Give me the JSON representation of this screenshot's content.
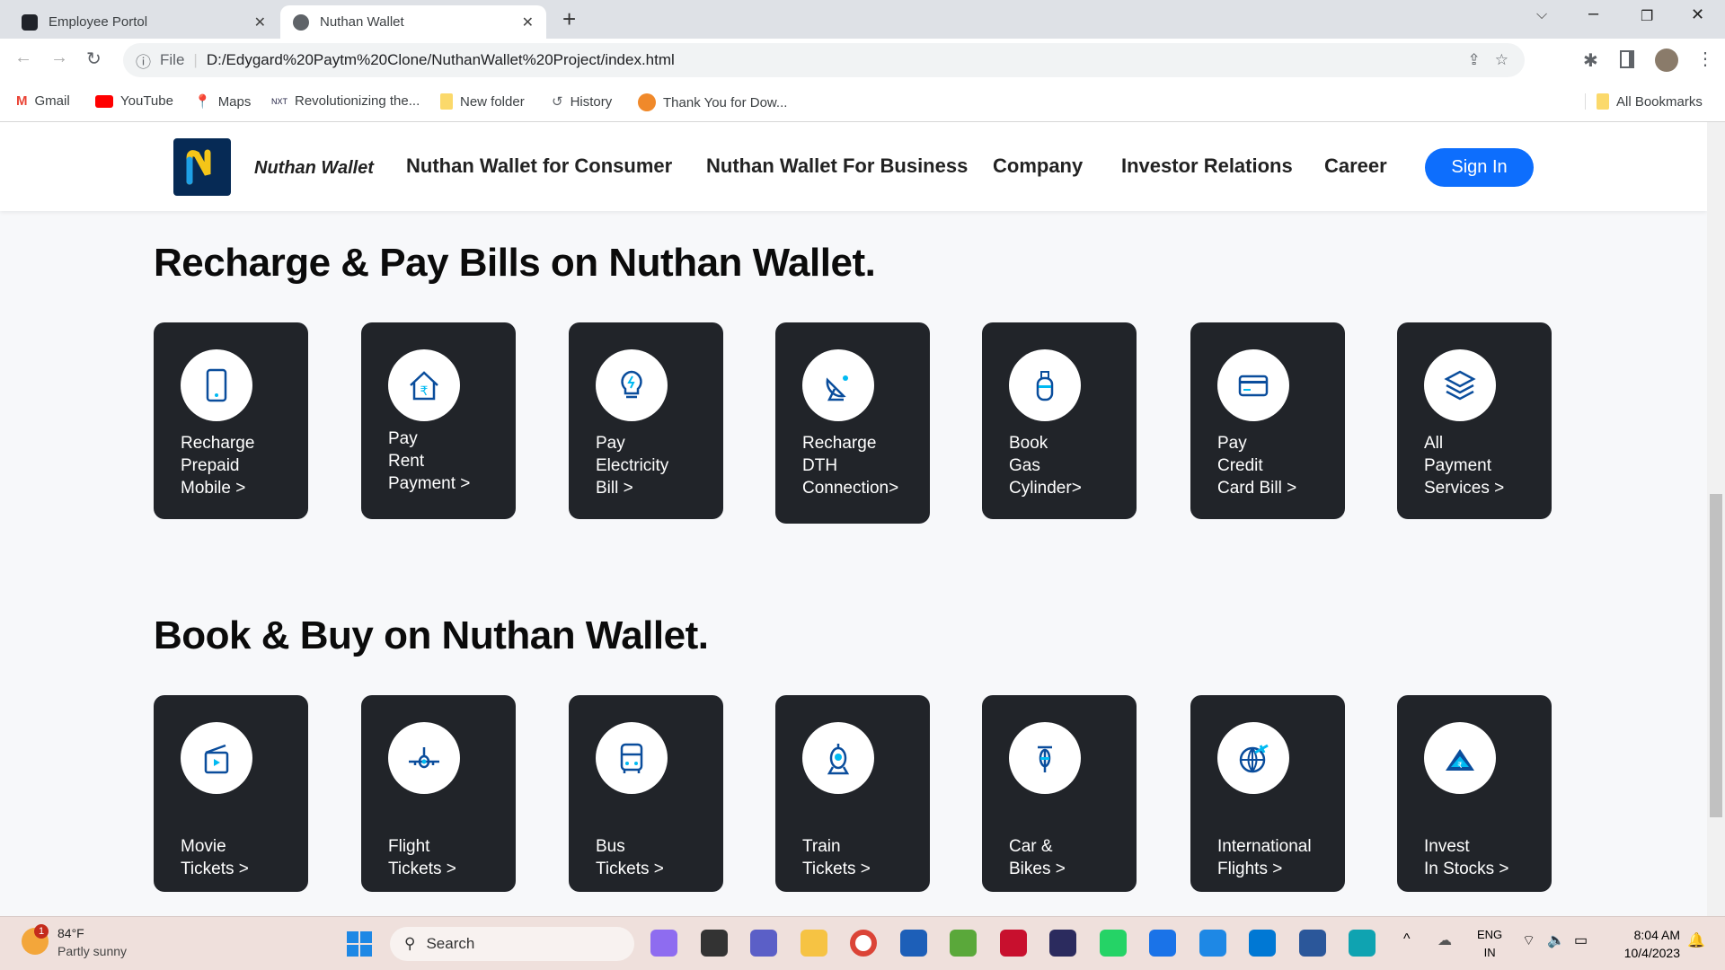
{
  "browser": {
    "tabs": [
      {
        "title": "Employee Portol",
        "active": false
      },
      {
        "title": "Nuthan Wallet",
        "active": true
      }
    ],
    "url_scheme": "File",
    "url": "D:/Edygard%20Paytm%20Clone/NuthanWallet%20Project/index.html",
    "bookmarks": [
      "Gmail",
      "YouTube",
      "Maps",
      "Revolutionizing the...",
      "New folder",
      "History",
      "Thank You for Dow..."
    ],
    "all_bookmarks": "All Bookmarks"
  },
  "site": {
    "brand": "Nuthan Wallet",
    "nav": [
      "Nuthan Wallet for Consumer",
      "Nuthan Wallet For Business",
      "Company",
      "Investor Relations",
      "Career"
    ],
    "signin": "Sign In",
    "sections": [
      {
        "title": "Recharge & Pay Bills on Nuthan Wallet.",
        "cards": [
          {
            "icon": "mobile-icon",
            "lines": [
              "Recharge",
              "Prepaid",
              "Mobile >"
            ]
          },
          {
            "icon": "rent-house-icon",
            "lines": [
              "Pay",
              "Rent",
              "Payment >"
            ]
          },
          {
            "icon": "bulb-icon",
            "lines": [
              "Pay",
              "Electricity",
              "Bill >"
            ]
          },
          {
            "icon": "satellite-dish-icon",
            "lines": [
              "Recharge",
              "DTH",
              "Connection>"
            ]
          },
          {
            "icon": "gas-cylinder-icon",
            "lines": [
              "Book",
              "Gas",
              "Cylinder>"
            ]
          },
          {
            "icon": "credit-card-icon",
            "lines": [
              "Pay",
              "Credit",
              "Card Bill >"
            ]
          },
          {
            "icon": "layers-icon",
            "lines": [
              "All",
              "Payment",
              "Services >"
            ]
          }
        ]
      },
      {
        "title": "Book & Buy on Nuthan Wallet.",
        "cards": [
          {
            "icon": "movie-icon",
            "lines": [
              "Movie",
              "Tickets >"
            ]
          },
          {
            "icon": "flight-icon",
            "lines": [
              "Flight",
              "Tickets >"
            ]
          },
          {
            "icon": "bus-icon",
            "lines": [
              "Bus",
              "Tickets >"
            ]
          },
          {
            "icon": "train-icon",
            "lines": [
              "Train",
              "Tickets >"
            ]
          },
          {
            "icon": "scooter-icon",
            "lines": [
              "Car &",
              "Bikes >"
            ]
          },
          {
            "icon": "globe-plane-icon",
            "lines": [
              "International",
              "Flights >"
            ]
          },
          {
            "icon": "stocks-icon",
            "lines": [
              "Invest",
              "In Stocks >"
            ]
          }
        ]
      }
    ]
  },
  "taskbar": {
    "temp": "84°F",
    "weather": "Partly sunny",
    "badge": "1",
    "search": "Search",
    "lang1": "ENG",
    "lang2": "IN",
    "time": "8:04 AM",
    "date": "10/4/2023"
  },
  "colors": {
    "card": "#212429",
    "accent": "#0d6efd",
    "icon": "#0a4d9c",
    "cyan": "#00baf2"
  }
}
